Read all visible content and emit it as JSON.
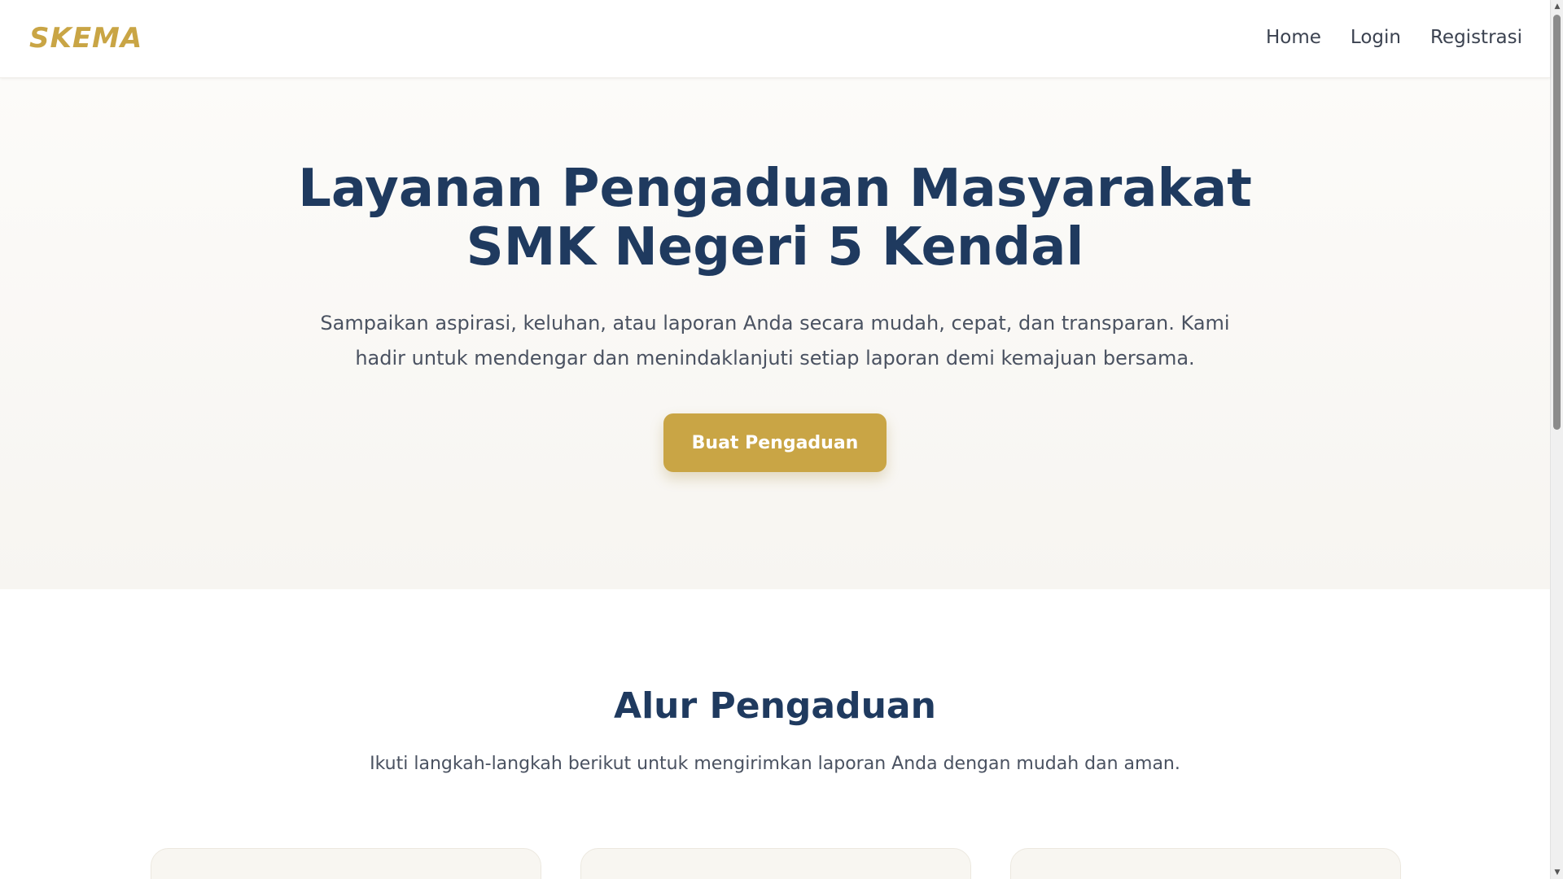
{
  "navbar": {
    "brand": "SKEMA",
    "links": [
      {
        "label": "Home"
      },
      {
        "label": "Login"
      },
      {
        "label": "Registrasi"
      }
    ]
  },
  "hero": {
    "title_line1": "Layanan Pengaduan Masyarakat",
    "title_line2": "SMK Negeri 5 Kendal",
    "subtitle": "Sampaikan aspirasi, keluhan, atau laporan Anda secara mudah, cepat, dan transparan. Kami hadir untuk mendengar dan menindaklanjuti setiap laporan demi kemajuan bersama.",
    "cta_label": "Buat Pengaduan"
  },
  "alur": {
    "title": "Alur Pengaduan",
    "subtitle": "Ikuti langkah-langkah berikut untuk mengirimkan laporan Anda dengan mudah dan aman."
  },
  "colors": {
    "brand_gold": "#c9a545",
    "heading_navy": "#1f3a5f",
    "body_text": "#4a5261"
  }
}
